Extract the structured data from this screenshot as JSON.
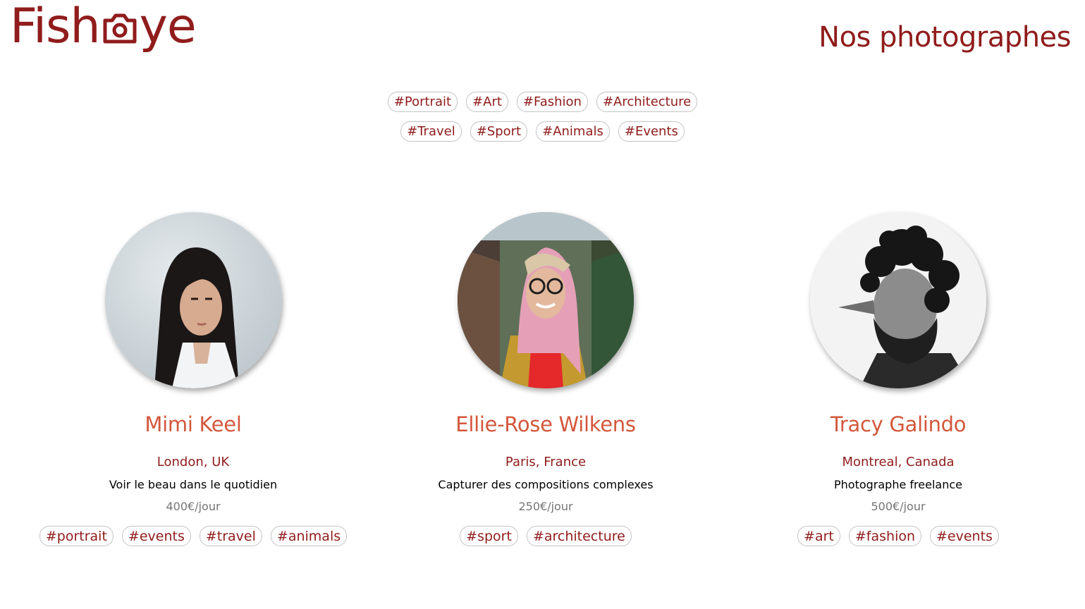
{
  "header": {
    "logo_left": "Fish",
    "logo_right": "ye",
    "title": "Nos photographes"
  },
  "filters": {
    "row1": [
      "#Portrait",
      "#Art",
      "#Fashion",
      "#Architecture"
    ],
    "row2": [
      "#Travel",
      "#Sport",
      "#Animals",
      "#Events"
    ]
  },
  "photographers": [
    {
      "name": "Mimi Keel",
      "location": "London, UK",
      "tagline": "Voir le beau dans le quotidien",
      "price": "400€/jour",
      "tags": [
        "#portrait",
        "#events",
        "#travel",
        "#animals"
      ]
    },
    {
      "name": "Ellie-Rose Wilkens",
      "location": "Paris, France",
      "tagline": "Capturer des compositions complexes",
      "price": "250€/jour",
      "tags": [
        "#sport",
        "#architecture"
      ]
    },
    {
      "name": "Tracy Galindo",
      "location": "Montreal, Canada",
      "tagline": "Photographe freelance",
      "price": "500€/jour",
      "tags": [
        "#art",
        "#fashion",
        "#events"
      ]
    }
  ],
  "colors": {
    "brand": "#901c1c",
    "name_accent": "#d3573c",
    "price_gray": "#757575",
    "tag_border": "#c4c4c4"
  },
  "icons": {
    "logo_camera": "camera-icon"
  }
}
